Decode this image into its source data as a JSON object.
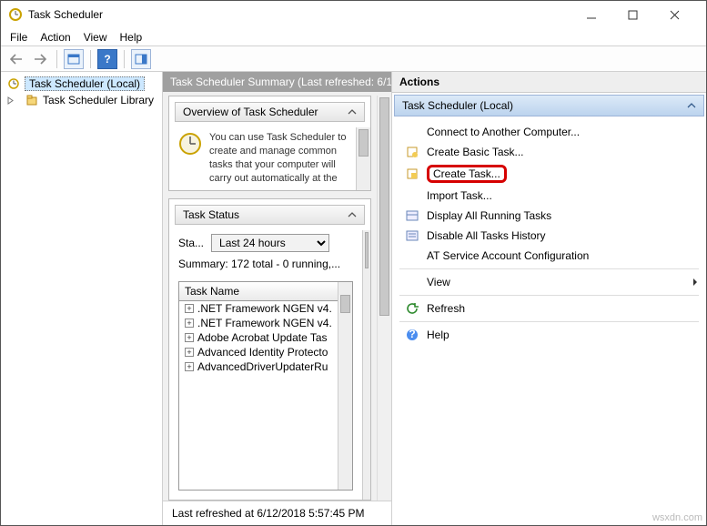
{
  "title": "Task Scheduler",
  "menu": {
    "file": "File",
    "action": "Action",
    "view": "View",
    "help": "Help"
  },
  "tree": {
    "root": "Task Scheduler (Local)",
    "library": "Task Scheduler Library"
  },
  "mid": {
    "header": "Task Scheduler Summary (Last refreshed: 6/1",
    "overview_title": "Overview of Task Scheduler",
    "overview_text": "You can use Task Scheduler to create and manage common tasks that your computer will carry out automatically at the",
    "task_status_title": "Task Status",
    "status_label": "Sta...",
    "status_dropdown": "Last 24 hours",
    "summary": "Summary: 172 total - 0 running,...",
    "taskname_header": "Task Name",
    "tasks": [
      ".NET Framework NGEN v4.",
      ".NET Framework NGEN v4.",
      "Adobe Acrobat Update Tas",
      "Advanced Identity Protecto",
      "AdvancedDriverUpdaterRu"
    ],
    "refreshed": "Last refreshed at 6/12/2018 5:57:45 PM"
  },
  "actions": {
    "head1": "Actions",
    "head2": "Task Scheduler (Local)",
    "items": {
      "connect": "Connect to Another Computer...",
      "create_basic": "Create Basic Task...",
      "create_task": "Create Task...",
      "import": "Import Task...",
      "display_running": "Display All Running Tasks",
      "disable_history": "Disable All Tasks History",
      "at_service": "AT Service Account Configuration",
      "view": "View",
      "refresh": "Refresh",
      "help": "Help"
    }
  },
  "hint": "wsxdn.com"
}
